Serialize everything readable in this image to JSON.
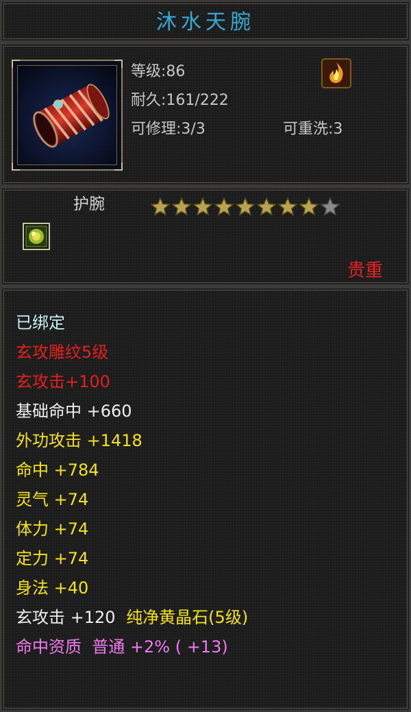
{
  "title": "沐水天腕",
  "info": {
    "level": "等级:86",
    "durability": "耐久:161/222",
    "repair": "可修理:3/3",
    "rewash": "可重洗:3"
  },
  "item": {
    "type": "护腕",
    "stars_total": 9,
    "stars_filled": 8,
    "quality": "贵重"
  },
  "attributes": {
    "bound": "已绑定",
    "engrave": "玄攻雕纹5级",
    "engrave_bonus": "玄攻击+100",
    "base_hit": "基础命中 +660",
    "ext_attack": "外功攻击 +1418",
    "hit": "命中 +784",
    "spirit": "灵气 +74",
    "stamina": "体力 +74",
    "focus": "定力 +74",
    "agility": "身法 +40",
    "gem_prefix": "玄攻击 +120",
    "gem_name": "纯净黄晶石(5级)",
    "aptitude": "命中资质  普通 +2% ( +13)"
  },
  "colors": {
    "title": "#38a8d4",
    "bound": "#c8f0f4",
    "engrave": "#e2201c",
    "base": "#efefef",
    "bonus": "#f4e414",
    "aptitude": "#f07af0",
    "quality": "#e8221c"
  },
  "icons": [
    "bracer-item-icon",
    "fire-skill-icon",
    "star-icon",
    "gem-socket-icon"
  ]
}
